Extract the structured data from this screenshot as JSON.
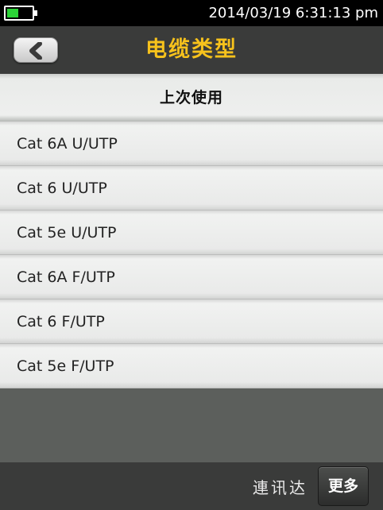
{
  "status": {
    "datetime": "2014/03/19 6:31:13 pm",
    "battery_level": 0.4,
    "battery_color": "#2bd437"
  },
  "header": {
    "title": "电缆类型",
    "title_color": "#f7c21c",
    "back_icon": "chevron-left-icon"
  },
  "section": {
    "label": "上次使用"
  },
  "cables": [
    {
      "label": "Cat 6A U/UTP"
    },
    {
      "label": "Cat 6 U/UTP"
    },
    {
      "label": "Cat 5e U/UTP"
    },
    {
      "label": "Cat 6A F/UTP"
    },
    {
      "label": "Cat 6 F/UTP"
    },
    {
      "label": "Cat 5e F/UTP"
    }
  ],
  "footer": {
    "brand": "連讯达",
    "more_label": "更多"
  }
}
